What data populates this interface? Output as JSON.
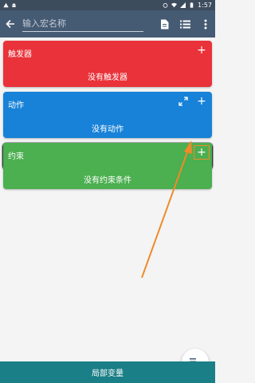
{
  "statusbar": {
    "time": "1:57"
  },
  "appbar": {
    "back_icon": "arrow-left-icon",
    "name_placeholder": "输入宏名称",
    "icons": [
      "document-icon",
      "list-icon",
      "more-vert-icon"
    ]
  },
  "cards": {
    "triggers": {
      "title": "触发器",
      "empty_text": "没有触发器",
      "color": "#e9323a"
    },
    "actions": {
      "title": "动作",
      "empty_text": "没有动作",
      "color": "#1782d8"
    },
    "constraints": {
      "title": "约束",
      "empty_text": "没有约束条件",
      "color": "#4caf50"
    }
  },
  "bottom": {
    "label": "局部变量"
  },
  "colors": {
    "appbar": "#455a73",
    "bottom": "#1b7f87",
    "annotation": "#f08a2a"
  }
}
